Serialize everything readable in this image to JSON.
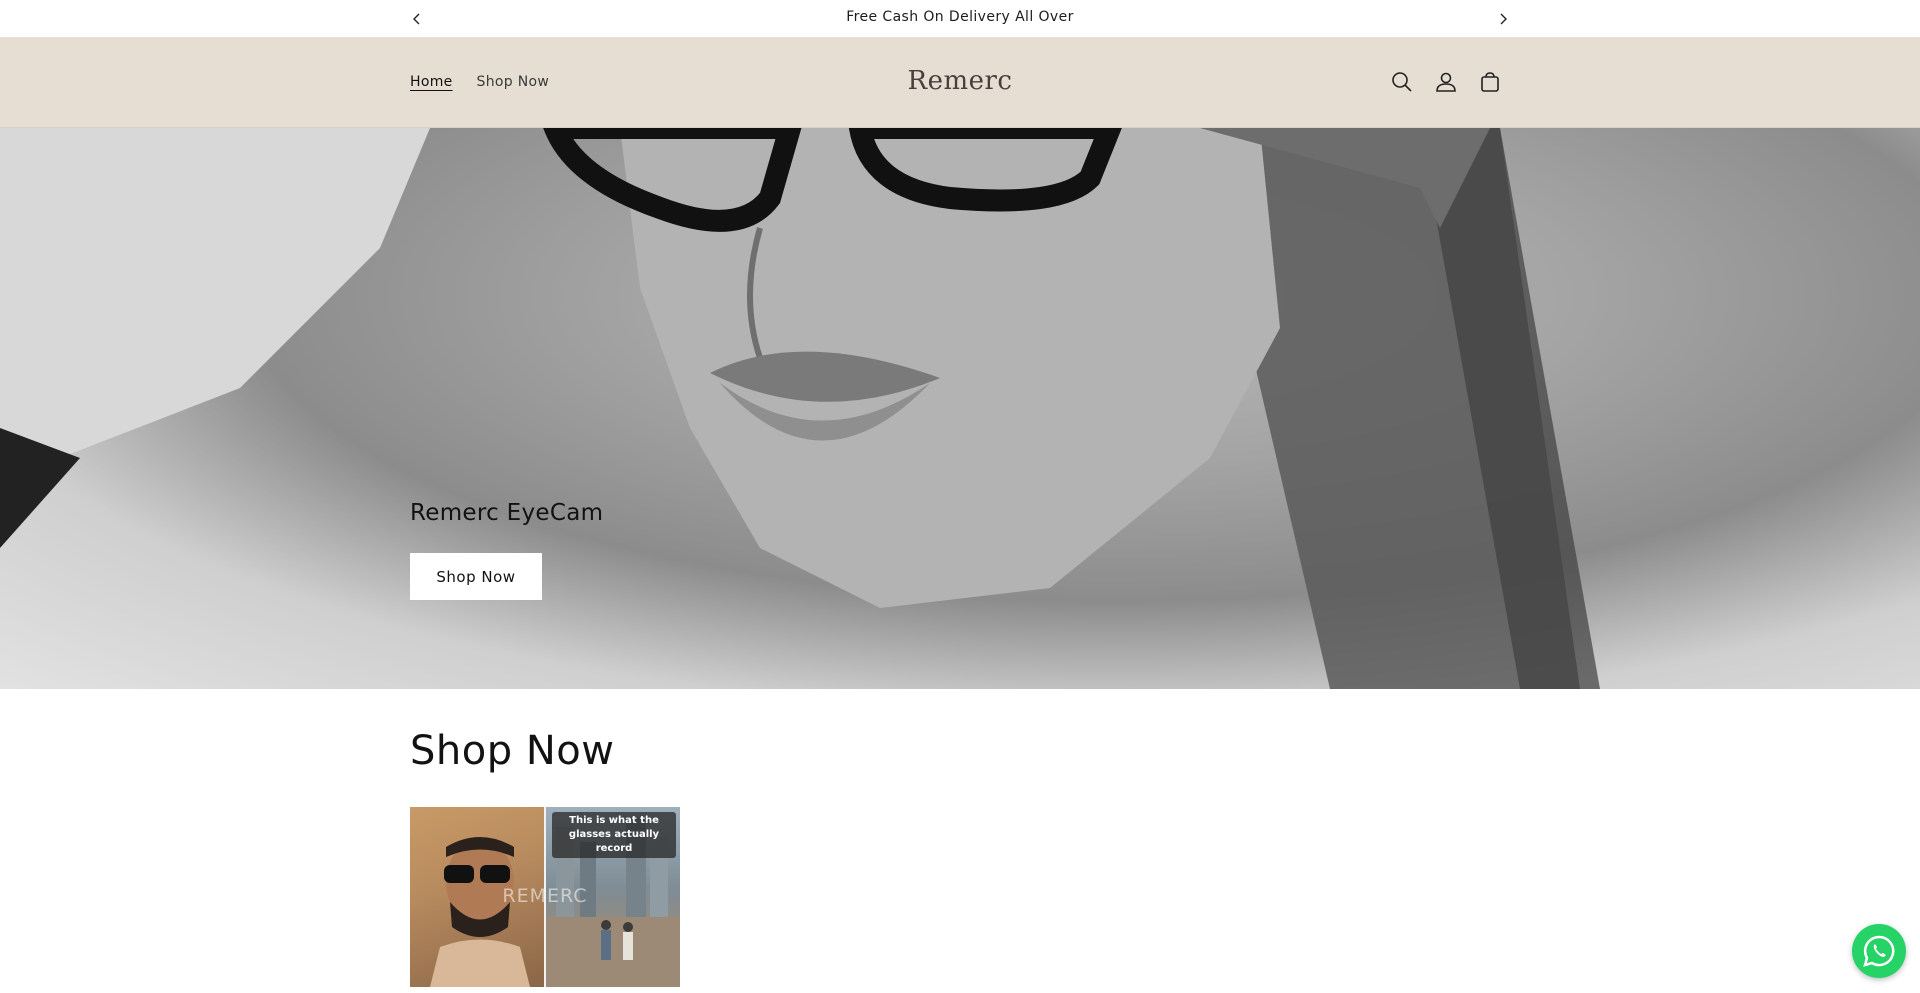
{
  "announcement": {
    "text": "Free Cash On Delivery All Over",
    "prev_icon": "chevron-left-icon",
    "next_icon": "chevron-right-icon"
  },
  "header": {
    "logo": "Remerc",
    "nav": [
      {
        "label": "Home",
        "active": true
      },
      {
        "label": "Shop Now",
        "active": false
      }
    ],
    "icons": [
      "search-icon",
      "account-icon",
      "cart-icon"
    ],
    "background": "#e7ded3"
  },
  "hero": {
    "title": "Remerc EyeCam",
    "button_label": "Shop Now"
  },
  "shop_section": {
    "title": "Shop Now",
    "product": {
      "caption": "This is what the glasses actually record",
      "watermark": "REMERC"
    }
  },
  "floating": {
    "icon": "whatsapp-icon",
    "color": "#25d366"
  }
}
